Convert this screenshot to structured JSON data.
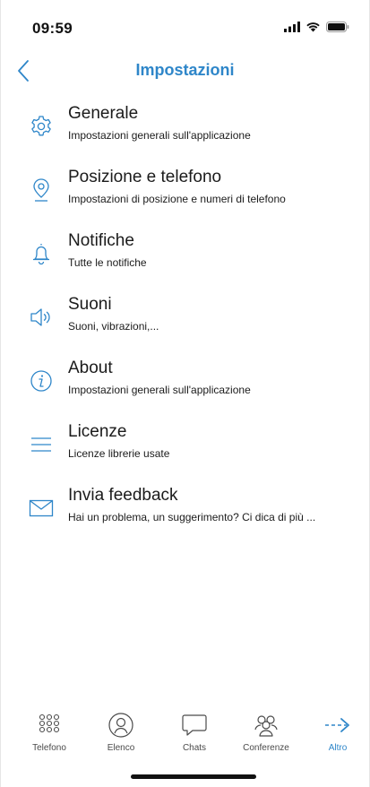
{
  "status_bar": {
    "time": "09:59"
  },
  "header": {
    "title": "Impostazioni"
  },
  "settings": [
    {
      "id": "generale",
      "icon": "gear-icon",
      "title": "Generale",
      "subtitle": "Impostazioni generali sull'applicazione"
    },
    {
      "id": "posizione",
      "icon": "location-pin-icon",
      "title": "Posizione e telefono",
      "subtitle": "Impostazioni di posizione e numeri di telefono"
    },
    {
      "id": "notifiche",
      "icon": "bell-icon",
      "title": "Notifiche",
      "subtitle": "Tutte le notifiche"
    },
    {
      "id": "suoni",
      "icon": "speaker-icon",
      "title": "Suoni",
      "subtitle": "Suoni, vibrazioni,..."
    },
    {
      "id": "about",
      "icon": "info-icon",
      "title": "About",
      "subtitle": "Impostazioni generali sull'applicazione"
    },
    {
      "id": "licenze",
      "icon": "menu-lines-icon",
      "title": "Licenze",
      "subtitle": "Licenze librerie usate"
    },
    {
      "id": "feedback",
      "icon": "envelope-icon",
      "title": "Invia feedback",
      "subtitle": "Hai un problema, un suggerimento? Ci dica di più ..."
    }
  ],
  "tabs": [
    {
      "id": "telefono",
      "icon": "keypad-icon",
      "label": "Telefono",
      "active": false
    },
    {
      "id": "elenco",
      "icon": "contact-icon",
      "label": "Elenco",
      "active": false
    },
    {
      "id": "chats",
      "icon": "chat-bubble-icon",
      "label": "Chats",
      "active": false
    },
    {
      "id": "conferenze",
      "icon": "group-icon",
      "label": "Conferenze",
      "active": false
    },
    {
      "id": "altro",
      "icon": "arrow-right-icon",
      "label": "Altro",
      "active": true
    }
  ],
  "colors": {
    "accent": "#2e86c9",
    "text": "#1b1b1b",
    "tab_inactive": "#4a4a4a"
  }
}
